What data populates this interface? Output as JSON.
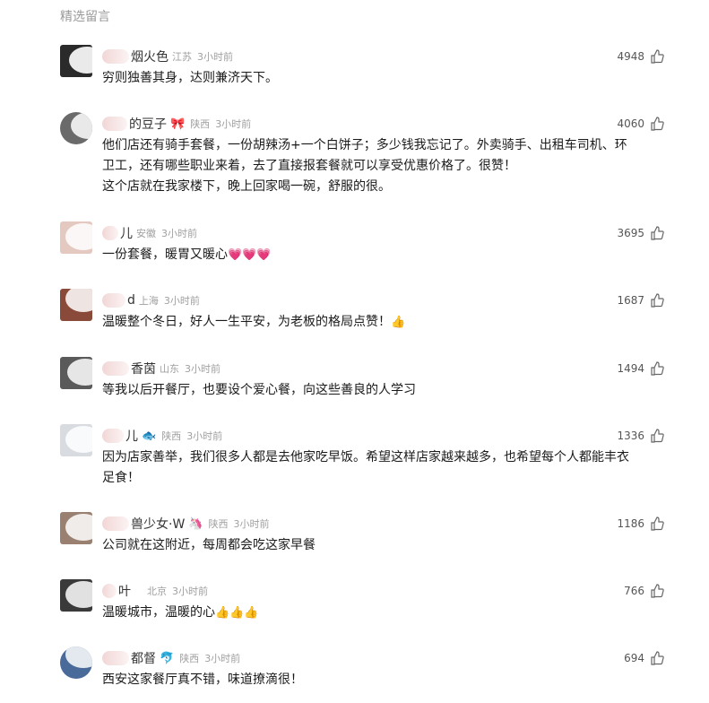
{
  "section_title": "精选留言",
  "comments": [
    {
      "name": "烟火色",
      "badge": "",
      "location": "江苏",
      "time": "3小时前",
      "likes": "4948",
      "text": [
        "穷则独善其身，达则兼济天下。"
      ],
      "emoji": ""
    },
    {
      "name": "的豆子",
      "badge": "🎀",
      "location": "陕西",
      "time": "3小时前",
      "likes": "4060",
      "text": [
        "他们店还有骑手套餐，一份胡辣汤+一个白饼子；多少钱我忘记了。外卖骑手、出租车司机、环",
        "卫工，还有哪些职业来着，去了直接报套餐就可以享受优惠价格了。很赞！",
        "这个店就在我家楼下，晚上回家喝一碗，舒服的很。"
      ],
      "emoji": ""
    },
    {
      "name": "儿",
      "badge": "",
      "location": "安徽",
      "time": "3小时前",
      "likes": "3695",
      "text": [
        "一份套餐，暖胃又暖心"
      ],
      "emoji": "💗💗💗"
    },
    {
      "name": "d",
      "badge": "",
      "location": "上海",
      "time": "3小时前",
      "likes": "1687",
      "text": [
        "温暖整个冬日，好人一生平安，为老板的格局点赞！"
      ],
      "emoji": "👍"
    },
    {
      "name": "香茵",
      "badge": "",
      "location": "山东",
      "time": "3小时前",
      "likes": "1494",
      "text": [
        "等我以后开餐厅，也要设个爱心餐，向这些善良的人学习"
      ],
      "emoji": ""
    },
    {
      "name": "儿",
      "badge": "🐟",
      "location": "陕西",
      "time": "3小时前",
      "likes": "1336",
      "text": [
        "因为店家善举，我们很多人都是去他家吃早饭。希望这样店家越来越多，也希望每个人都能丰衣",
        "足食！"
      ],
      "emoji": ""
    },
    {
      "name": "兽少女·W",
      "badge": "🦄",
      "location": "陕西",
      "time": "3小时前",
      "likes": "1186",
      "text": [
        "公司就在这附近，每周都会吃这家早餐"
      ],
      "emoji": ""
    },
    {
      "name": "叶",
      "badge": "",
      "location": "北京",
      "time": "3小时前",
      "likes": "766",
      "text": [
        "温暖城市，温暖的心"
      ],
      "emoji": "👍👍👍"
    },
    {
      "name": "都督",
      "badge": "🐬",
      "location": "陕西",
      "time": "3小时前",
      "likes": "694",
      "text": [
        "西安这家餐厅真不错，味道撩滴很！"
      ],
      "emoji": ""
    }
  ]
}
